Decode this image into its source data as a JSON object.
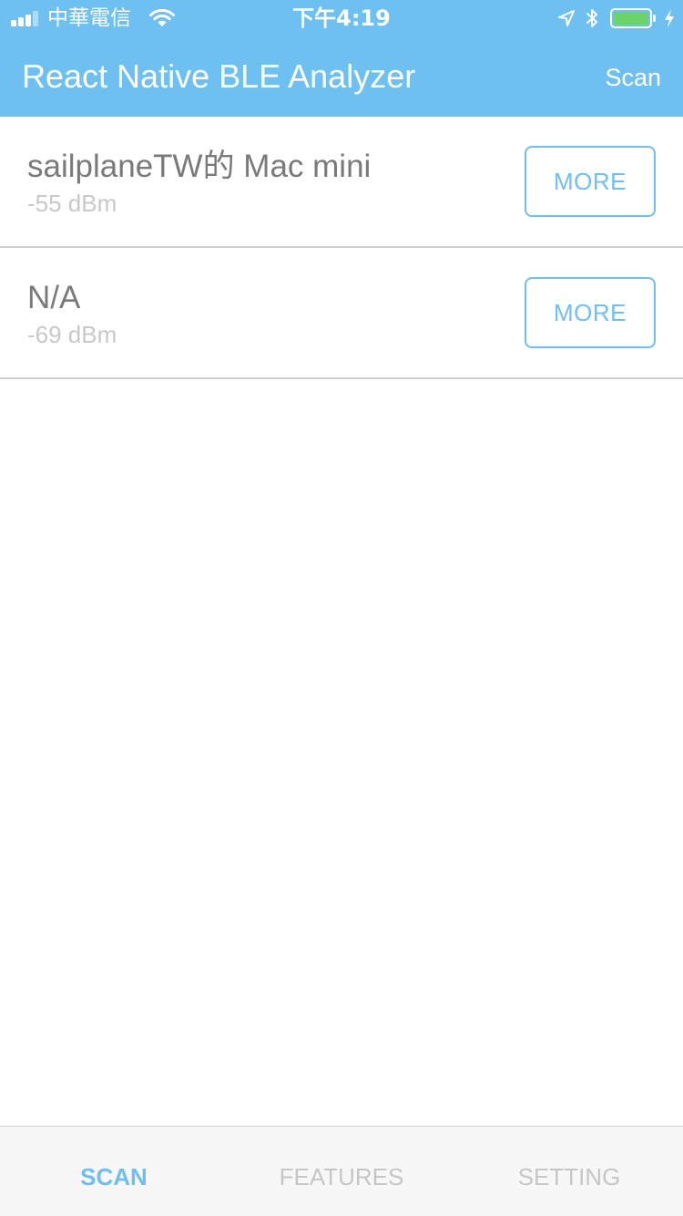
{
  "status_bar": {
    "carrier": "中華電信",
    "time": "下午4:19",
    "signal_bars_filled": 3,
    "battery_level": 1.0,
    "icons": [
      "signal-icon",
      "wifi-icon",
      "location-icon",
      "bluetooth-icon",
      "battery-icon",
      "charging-icon"
    ]
  },
  "nav": {
    "title": "React Native BLE Analyzer",
    "scan_label": "Scan"
  },
  "devices": [
    {
      "name": "sailplaneTW的 Mac mini",
      "rssi": "-55 dBm",
      "button_label": "MORE"
    },
    {
      "name": "N/A",
      "rssi": "-69 dBm",
      "button_label": "MORE"
    }
  ],
  "tabs": [
    {
      "label": "SCAN",
      "active": true
    },
    {
      "label": "FEATURES",
      "active": false
    },
    {
      "label": "SETTING",
      "active": false
    }
  ],
  "colors": {
    "accent": "#6ec0f0",
    "text_primary": "#7a7a7a",
    "text_secondary": "#c8c8c8",
    "tab_inactive": "#c6c6c6",
    "battery_fill": "#6cd36a"
  }
}
